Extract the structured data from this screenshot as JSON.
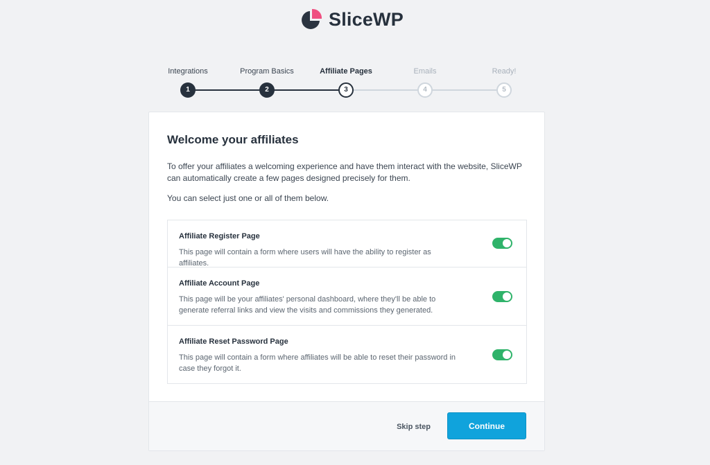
{
  "brand": {
    "name": "SliceWP",
    "logo_dark": "#2b3440",
    "logo_accent": "#ef4f80"
  },
  "stepper": {
    "steps": [
      {
        "label": "Integrations",
        "number": "1",
        "state": "done"
      },
      {
        "label": "Program Basics",
        "number": "2",
        "state": "done"
      },
      {
        "label": "Affiliate Pages",
        "number": "3",
        "state": "active"
      },
      {
        "label": "Emails",
        "number": "4",
        "state": "todo"
      },
      {
        "label": "Ready!",
        "number": "5",
        "state": "todo"
      }
    ]
  },
  "card": {
    "title": "Welcome your affiliates",
    "description": "To offer your affiliates a welcoming experience and have them interact with the website, SliceWP can automatically create a few pages designed precisely for them.",
    "note": "You can select just one or all of them below.",
    "options": [
      {
        "title": "Affiliate Register Page",
        "description": "This page will contain a form where users will have the ability to register as affiliates.",
        "enabled": true
      },
      {
        "title": "Affiliate Account Page",
        "description": "This page will be your affiliates' personal dashboard, where they'll be able to generate referral links and view the visits and commissions they generated.",
        "enabled": true
      },
      {
        "title": "Affiliate Reset Password Page",
        "description": "This page will contain a form where affiliates will be able to reset their password in case they forgot it.",
        "enabled": true
      }
    ]
  },
  "footer": {
    "skip_label": "Skip step",
    "continue_label": "Continue"
  },
  "colors": {
    "toggle_on": "#2fb36a",
    "primary_button": "#10a3dc",
    "step_done": "#27313d",
    "step_todo": "#cfd6dd"
  },
  "icons": {
    "logo": "pie-chart-icon"
  }
}
